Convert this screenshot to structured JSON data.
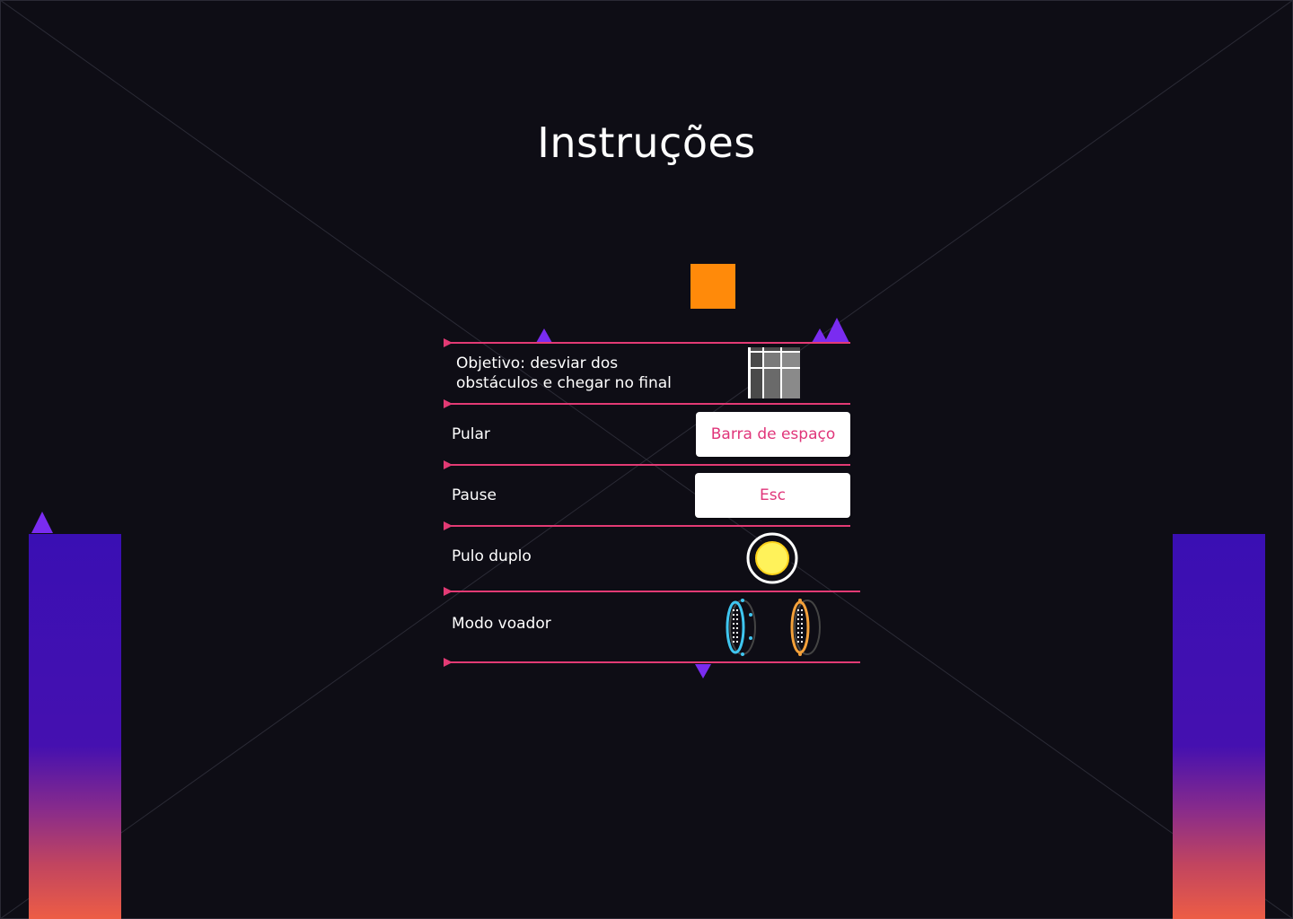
{
  "title": "Instruções",
  "instructions": [
    {
      "label": "Objetivo: desviar dos obstáculos e chegar no final",
      "icon": "finish-flag-icon"
    },
    {
      "label": "Pular",
      "key": "Barra de espaço"
    },
    {
      "label": "Pause",
      "key": "Esc"
    },
    {
      "label": "Pulo duplo",
      "icon": "jump-orb-icon"
    },
    {
      "label": "Modo voador",
      "icons": [
        "blue-portal-icon",
        "orange-portal-icon"
      ]
    }
  ],
  "colors": {
    "background": "#0e0d15",
    "accent_line": "#e23a74",
    "spike": "#7a2cf0",
    "player": "#ff8a0a",
    "key_text": "#e0357a",
    "orb": "#fff25a"
  }
}
